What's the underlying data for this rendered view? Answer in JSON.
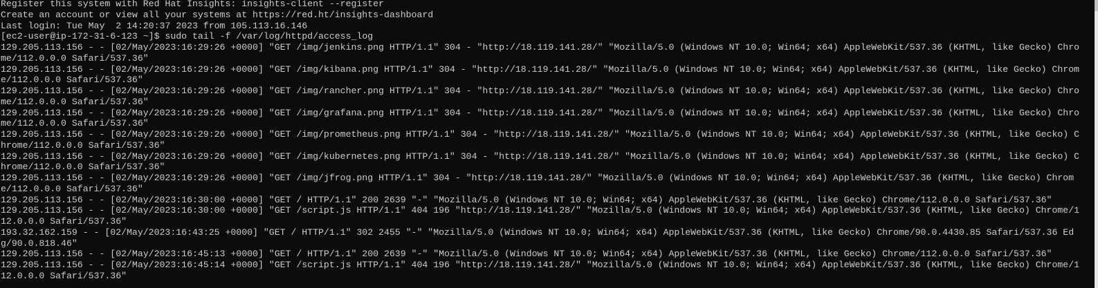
{
  "terminal": {
    "motd": [
      "Register this system with Red Hat Insights: insights-client --register",
      "Create an account or view all your systems at https://red.ht/insights-dashboard",
      "Last login: Tue May  2 14:20:37 2023 from 105.113.16.146"
    ],
    "prompt": "[ec2-user@ip-172-31-6-123 ~]$ ",
    "command": "sudo tail -f /var/log/httpd/access_log",
    "log_lines": [
      "129.205.113.156 - - [02/May/2023:16:29:26 +0000] \"GET /img/jenkins.png HTTP/1.1\" 304 - \"http://18.119.141.28/\" \"Mozilla/5.0 (Windows NT 10.0; Win64; x64) AppleWebKit/537.36 (KHTML, like Gecko) Chrome/112.0.0.0 Safari/537.36\"",
      "129.205.113.156 - - [02/May/2023:16:29:26 +0000] \"GET /img/kibana.png HTTP/1.1\" 304 - \"http://18.119.141.28/\" \"Mozilla/5.0 (Windows NT 10.0; Win64; x64) AppleWebKit/537.36 (KHTML, like Gecko) Chrome/112.0.0.0 Safari/537.36\"",
      "129.205.113.156 - - [02/May/2023:16:29:26 +0000] \"GET /img/rancher.png HTTP/1.1\" 304 - \"http://18.119.141.28/\" \"Mozilla/5.0 (Windows NT 10.0; Win64; x64) AppleWebKit/537.36 (KHTML, like Gecko) Chrome/112.0.0.0 Safari/537.36\"",
      "129.205.113.156 - - [02/May/2023:16:29:26 +0000] \"GET /img/grafana.png HTTP/1.1\" 304 - \"http://18.119.141.28/\" \"Mozilla/5.0 (Windows NT 10.0; Win64; x64) AppleWebKit/537.36 (KHTML, like Gecko) Chrome/112.0.0.0 Safari/537.36\"",
      "129.205.113.156 - - [02/May/2023:16:29:26 +0000] \"GET /img/prometheus.png HTTP/1.1\" 304 - \"http://18.119.141.28/\" \"Mozilla/5.0 (Windows NT 10.0; Win64; x64) AppleWebKit/537.36 (KHTML, like Gecko) Chrome/112.0.0.0 Safari/537.36\"",
      "129.205.113.156 - - [02/May/2023:16:29:26 +0000] \"GET /img/kubernetes.png HTTP/1.1\" 304 - \"http://18.119.141.28/\" \"Mozilla/5.0 (Windows NT 10.0; Win64; x64) AppleWebKit/537.36 (KHTML, like Gecko) Chrome/112.0.0.0 Safari/537.36\"",
      "129.205.113.156 - - [02/May/2023:16:29:26 +0000] \"GET /img/jfrog.png HTTP/1.1\" 304 - \"http://18.119.141.28/\" \"Mozilla/5.0 (Windows NT 10.0; Win64; x64) AppleWebKit/537.36 (KHTML, like Gecko) Chrome/112.0.0.0 Safari/537.36\"",
      "129.205.113.156 - - [02/May/2023:16:30:00 +0000] \"GET / HTTP/1.1\" 200 2639 \"-\" \"Mozilla/5.0 (Windows NT 10.0; Win64; x64) AppleWebKit/537.36 (KHTML, like Gecko) Chrome/112.0.0.0 Safari/537.36\"",
      "129.205.113.156 - - [02/May/2023:16:30:00 +0000] \"GET /script.js HTTP/1.1\" 404 196 \"http://18.119.141.28/\" \"Mozilla/5.0 (Windows NT 10.0; Win64; x64) AppleWebKit/537.36 (KHTML, like Gecko) Chrome/112.0.0.0 Safari/537.36\"",
      "193.32.162.159 - - [02/May/2023:16:43:25 +0000] \"GET / HTTP/1.1\" 302 2455 \"-\" \"Mozilla/5.0 (Windows NT 10.0; Win64; x64) AppleWebKit/537.36 (KHTML, like Gecko) Chrome/90.0.4430.85 Safari/537.36 Edg/90.0.818.46\"",
      "129.205.113.156 - - [02/May/2023:16:45:13 +0000] \"GET / HTTP/1.1\" 200 2639 \"-\" \"Mozilla/5.0 (Windows NT 10.0; Win64; x64) AppleWebKit/537.36 (KHTML, like Gecko) Chrome/112.0.0.0 Safari/537.36\"",
      "129.205.113.156 - - [02/May/2023:16:45:14 +0000] \"GET /script.js HTTP/1.1\" 404 196 \"http://18.119.141.28/\" \"Mozilla/5.0 (Windows NT 10.0; Win64; x64) AppleWebKit/537.36 (KHTML, like Gecko) Chrome/112.0.0.0 Safari/537.36\""
    ]
  },
  "colors": {
    "background": "#0c0c0c",
    "foreground": "#cccccc"
  }
}
